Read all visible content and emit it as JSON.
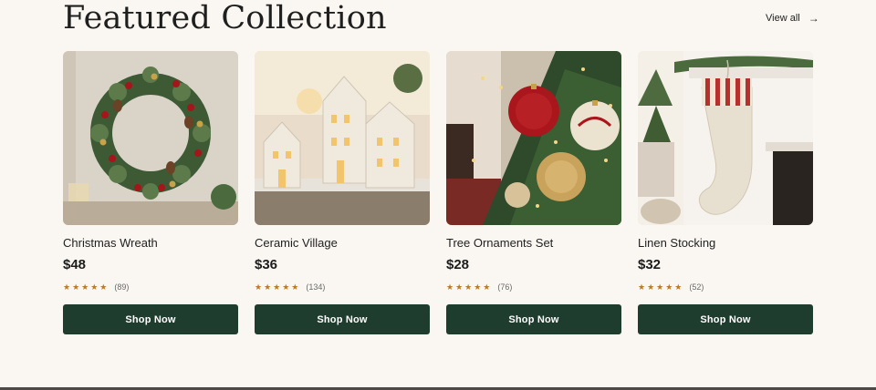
{
  "section": {
    "title": "Featured Collection",
    "view_all_label": "View all",
    "view_all_icon": "arrow-right-icon"
  },
  "products": [
    {
      "name": "Christmas Wreath",
      "price": "$48",
      "stars": "★★★★★",
      "reviews": "(89)",
      "button_label": "Shop Now",
      "image": "wreath-photo"
    },
    {
      "name": "Ceramic Village",
      "price": "$36",
      "stars": "★★★★★",
      "reviews": "(134)",
      "button_label": "Shop Now",
      "image": "ceramic-houses-photo"
    },
    {
      "name": "Tree Ornaments Set",
      "price": "$28",
      "stars": "★★★★★",
      "reviews": "(76)",
      "button_label": "Shop Now",
      "image": "ornaments-photo"
    },
    {
      "name": "Linen Stocking",
      "price": "$32",
      "stars": "★★★★★",
      "reviews": "(52)",
      "button_label": "Shop Now",
      "image": "stocking-photo"
    }
  ],
  "colors": {
    "background": "#faf7f2",
    "button": "#1f3d2f",
    "star": "#b77a2a"
  }
}
